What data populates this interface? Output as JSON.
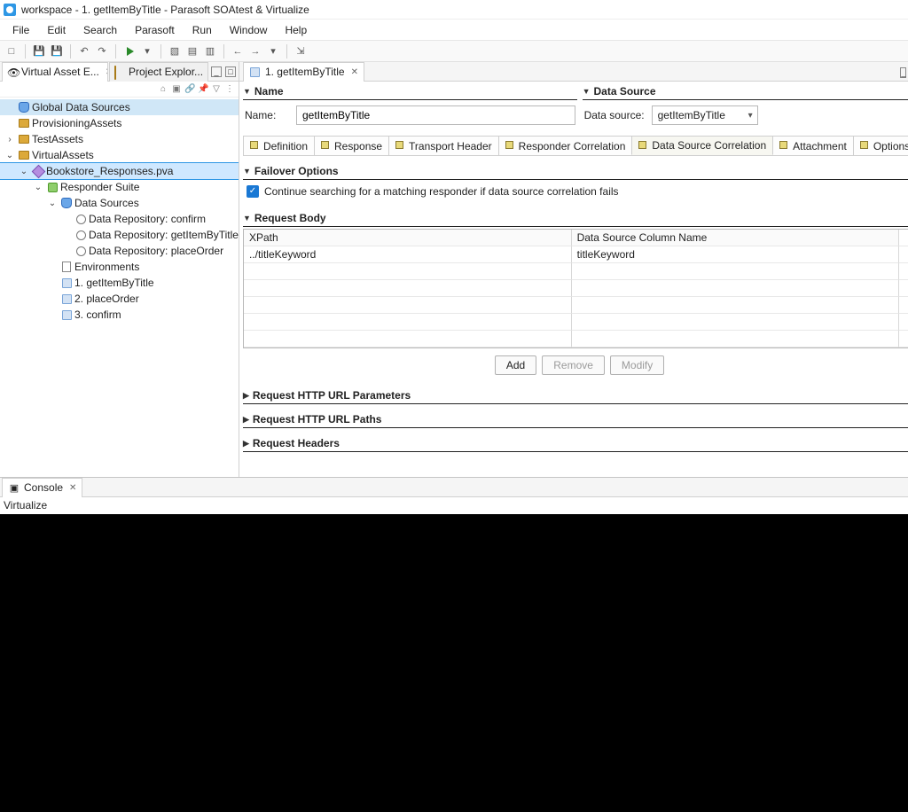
{
  "window_title": "workspace - 1. getItemByTitle - Parasoft SOAtest & Virtualize",
  "menu": [
    "File",
    "Edit",
    "Search",
    "Parasoft",
    "Run",
    "Window",
    "Help"
  ],
  "left_tabs": [
    {
      "label": "Virtual Asset E...",
      "closable": true
    },
    {
      "label": "Project Explor...",
      "closable": false
    }
  ],
  "tree": {
    "items": [
      {
        "indent": 0,
        "tw": "none",
        "icon": "db",
        "label": "Global Data Sources",
        "sel": "sel2"
      },
      {
        "indent": 0,
        "tw": "none",
        "icon": "fold",
        "label": "ProvisioningAssets"
      },
      {
        "indent": 0,
        "tw": "closed",
        "icon": "fold",
        "label": "TestAssets"
      },
      {
        "indent": 0,
        "tw": "open",
        "icon": "fold",
        "label": "VirtualAssets"
      },
      {
        "indent": 1,
        "tw": "open",
        "icon": "hex",
        "label": "Bookstore_Responses.pva",
        "sel": "sel"
      },
      {
        "indent": 2,
        "tw": "open",
        "icon": "green",
        "label": "Responder Suite"
      },
      {
        "indent": 3,
        "tw": "open",
        "icon": "db",
        "label": "Data Sources"
      },
      {
        "indent": 4,
        "tw": "none",
        "icon": "chain",
        "label": "Data Repository: confirm"
      },
      {
        "indent": 4,
        "tw": "none",
        "icon": "chain",
        "label": "Data Repository: getItemByTitle"
      },
      {
        "indent": 4,
        "tw": "none",
        "icon": "chain",
        "label": "Data Repository: placeOrder"
      },
      {
        "indent": 3,
        "tw": "none",
        "icon": "file",
        "label": "Environments"
      },
      {
        "indent": 3,
        "tw": "none",
        "icon": "msg",
        "label": "1. getItemByTitle"
      },
      {
        "indent": 3,
        "tw": "none",
        "icon": "msg",
        "label": "2. placeOrder"
      },
      {
        "indent": 3,
        "tw": "none",
        "icon": "msg",
        "label": "3. confirm"
      }
    ]
  },
  "editor_tab": "1. getItemByTitle",
  "sections": {
    "name_title": "Name",
    "name_label": "Name:",
    "name_value": "getItemByTitle",
    "ds_title": "Data Source",
    "ds_label": "Data source:",
    "ds_value": "getItemByTitle"
  },
  "inner_tabs": [
    "Definition",
    "Response",
    "Transport Header",
    "Responder Correlation",
    "Data Source Correlation",
    "Attachment",
    "Options"
  ],
  "inner_tabs_active": 4,
  "failover_title": "Failover Options",
  "failover_check": "Continue searching for a matching responder if data source correlation fails",
  "req_body_title": "Request Body",
  "grid": {
    "headers": [
      "XPath",
      "Data Source Column Name"
    ],
    "rows": [
      [
        "../titleKeyword",
        "titleKeyword"
      ]
    ]
  },
  "buttons": {
    "add": "Add",
    "remove": "Remove",
    "modify": "Modify"
  },
  "collapsed": [
    "Request HTTP URL Parameters",
    "Request HTTP URL Paths",
    "Request Headers"
  ],
  "console_tab": "Console",
  "console_text": "Virtualize"
}
